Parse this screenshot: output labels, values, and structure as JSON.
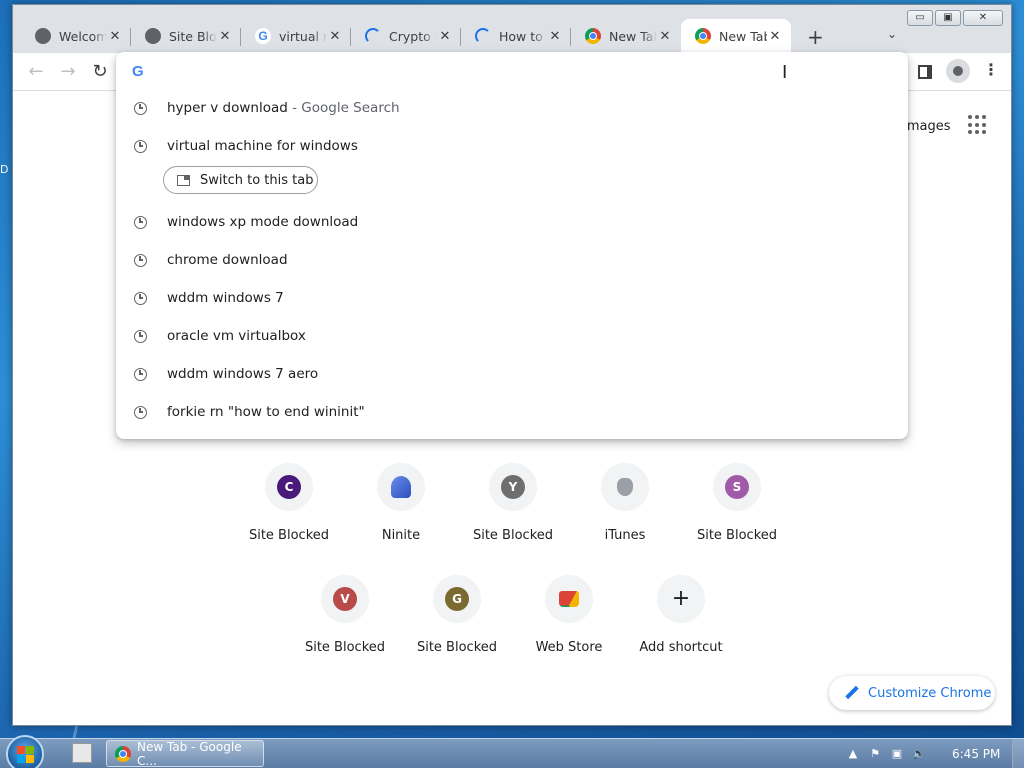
{
  "desktop": {
    "side_label": "D"
  },
  "window": {
    "controls": {
      "minimize": "▭",
      "maximize": "▣",
      "close": "✕"
    }
  },
  "tabs": [
    {
      "title": "Welcome",
      "favicon": "globe-icon",
      "close": "✕"
    },
    {
      "title": "Site Blocked",
      "favicon": "globe-icon",
      "close": "✕"
    },
    {
      "title": "virtual machine",
      "favicon": "google-icon",
      "close": "✕"
    },
    {
      "title": "Crypto D",
      "favicon": "loading-spinner-icon",
      "close": "✕"
    },
    {
      "title": "How to",
      "favicon": "loading-spinner-icon",
      "close": "✕"
    },
    {
      "title": "New Tab",
      "favicon": "chrome-icon",
      "close": "✕"
    },
    {
      "title": "New Tab",
      "favicon": "chrome-icon",
      "close": "✕",
      "active": true
    }
  ],
  "tabstrip": {
    "new_tab": "+",
    "tab_search": "⌄"
  },
  "toolbar": {
    "back": "←",
    "forward": "→",
    "reload": "↻",
    "menu": "⋮"
  },
  "omnibox": {
    "value": "",
    "google_glyph": "G",
    "suggestions": [
      {
        "text": "hyper v download",
        "hint": " - Google Search"
      },
      {
        "text": "virtual machine for windows",
        "hint": ""
      },
      {
        "text": "windows xp mode download",
        "hint": ""
      },
      {
        "text": "chrome download",
        "hint": ""
      },
      {
        "text": "wddm windows 7",
        "hint": ""
      },
      {
        "text": "oracle vm virtualbox",
        "hint": ""
      },
      {
        "text": "wddm windows 7 aero",
        "hint": ""
      },
      {
        "text": "forkie rn \"how to end wininit\"",
        "hint": ""
      }
    ],
    "switch_tab_label": "Switch to this tab"
  },
  "ntp": {
    "images_link": "Images",
    "shortcuts_row1": [
      {
        "letter": "C",
        "label": "Site Blocked",
        "color": "#4a1a7a"
      },
      {
        "letter": "",
        "label": "Ninite",
        "icon": "ninite-icon"
      },
      {
        "letter": "Y",
        "label": "Site Blocked",
        "color": "#6e6e6e"
      },
      {
        "letter": "",
        "label": "iTunes",
        "icon": "apple-icon"
      },
      {
        "letter": "S",
        "label": "Site Blocked",
        "color": "#a05aa8"
      }
    ],
    "shortcuts_row2": [
      {
        "letter": "V",
        "label": "Site Blocked",
        "color": "#b84a4a"
      },
      {
        "letter": "G",
        "label": "Site Blocked",
        "color": "#7a6a30"
      },
      {
        "letter": "",
        "label": "Web Store",
        "icon": "web-store-icon"
      },
      {
        "letter": "+",
        "label": "Add shortcut",
        "icon": "plus-icon"
      }
    ],
    "customize_label": "Customize Chrome"
  },
  "taskbar": {
    "chrome_item": "New Tab - Google C...",
    "clock": "6:45 PM",
    "tray_show_hidden": "▲"
  }
}
